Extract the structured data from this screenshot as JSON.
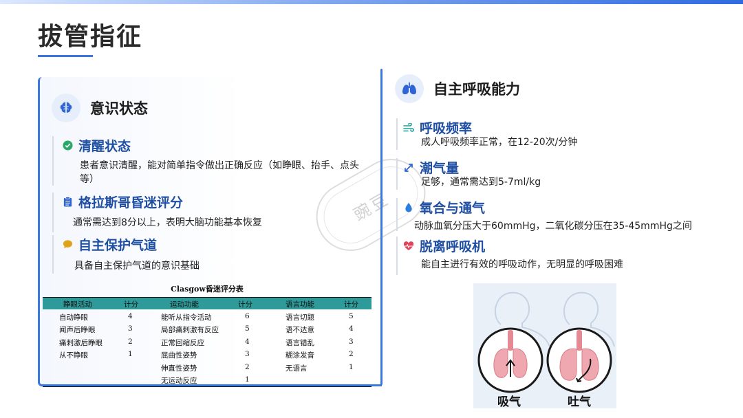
{
  "page": {
    "title": "拔管指征"
  },
  "consciousness": {
    "title": "意识状态",
    "icon": "brain-icon",
    "items": [
      {
        "title": "清醒状态",
        "icon": "check-circle-icon",
        "desc": "患者意识清醒，能对简单指令做出正确反应（如睁眼、抬手、点头等）"
      },
      {
        "title": "格拉斯哥昏迷评分",
        "icon": "clipboard-icon",
        "desc": "通常需达到8分以上，表明大脑功能基本恢复"
      },
      {
        "title": "自主保护气道",
        "icon": "speech-bubble-icon",
        "desc": "具备自主保护气道的意识基础"
      }
    ]
  },
  "gcs_table": {
    "caption": "Clasgow昏迷评分表",
    "headers": [
      "睁眼活动",
      "计分",
      "运动功能",
      "计分",
      "语言功能",
      "计分"
    ],
    "eye": [
      {
        "label": "自动睁眼",
        "score": "4"
      },
      {
        "label": "闻声后睁眼",
        "score": "3"
      },
      {
        "label": "痛刺激后睁眼",
        "score": "2"
      },
      {
        "label": "从不睁眼",
        "score": "1"
      }
    ],
    "motor": [
      {
        "label": "能听从指令活动",
        "score": "6"
      },
      {
        "label": "局部痛刺激有反应",
        "score": "5"
      },
      {
        "label": "正常回缩反应",
        "score": "4"
      },
      {
        "label": "屈曲性姿势",
        "score": "3"
      },
      {
        "label": "伸直性姿势",
        "score": "2"
      },
      {
        "label": "无运动反应",
        "score": "1"
      }
    ],
    "verbal": [
      {
        "label": "语言切题",
        "score": "5"
      },
      {
        "label": "语不达意",
        "score": "4"
      },
      {
        "label": "语言错乱",
        "score": "3"
      },
      {
        "label": "糊涂发音",
        "score": "2"
      },
      {
        "label": "无语言",
        "score": "1"
      }
    ]
  },
  "breathing": {
    "title": "自主呼吸能力",
    "icon": "lungs-icon",
    "items": [
      {
        "title": "呼吸频率",
        "icon": "wind-icon",
        "desc": "成人呼吸频率正常，在12-20次/分钟"
      },
      {
        "title": "潮气量",
        "icon": "expand-arrows-icon",
        "desc": "足够，通常需达到5-7ml/kg"
      },
      {
        "title": "氧合与通气",
        "icon": "droplet-icon",
        "desc": "动脉血氧分压大于60mmHg，二氧化碳分压在35-45mmHg之间"
      },
      {
        "title": "脱离呼吸机",
        "icon": "heartbeat-icon",
        "desc": "能自主进行有效的呼吸动作，无明显的呼吸困难"
      }
    ]
  },
  "illustration": {
    "inhale_label": "吸气",
    "exhale_label": "吐气"
  },
  "watermark": {
    "text": "豌豆"
  },
  "colors": {
    "accent": "#3a78e0",
    "heading_blue": "#1f4fa3",
    "table_header": "#2e9a9a"
  }
}
